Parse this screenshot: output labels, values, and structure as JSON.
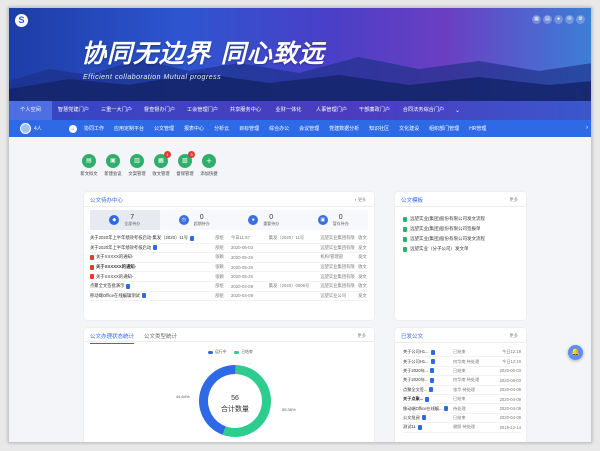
{
  "header": {
    "logo_glyph": "S",
    "slogan": "协同无边界 同心致远",
    "slogan_en": "Efficient collaboration Mutual progress",
    "top_icons": [
      "grid-icon",
      "apps-icon",
      "user-icon",
      "chat-icon",
      "settings-icon"
    ]
  },
  "nav_main": {
    "items": [
      "个人空间",
      "智慧党建门户",
      "三重一大门户",
      "督查督办门户",
      "工会管理门户",
      "共享服务中心",
      "业财一体化",
      "人事管理门户",
      "干部廉政门户",
      "合同法务综合门户"
    ],
    "more": "⌄"
  },
  "nav_sub": {
    "user_count": "4人",
    "items": [
      "协同工作",
      "应用定制平台",
      "公文管理",
      "报表中心",
      "分析云",
      "目标管理",
      "综合办公",
      "会议管理",
      "党建数据分析",
      "知识社区",
      "文化建设",
      "组织部门管理",
      "HR管理"
    ]
  },
  "quick_actions": [
    {
      "label": "新文拟文",
      "color": "#2eaf6a",
      "badge": ""
    },
    {
      "label": "新建会议",
      "color": "#2eaf6a",
      "badge": ""
    },
    {
      "label": "文案管理",
      "color": "#2eaf6a",
      "badge": ""
    },
    {
      "label": "收文管理",
      "color": "#2eaf6a",
      "badge": "1"
    },
    {
      "label": "督保管理",
      "color": "#2eaf6a",
      "badge": "3"
    },
    {
      "label": "添加快捷",
      "color": "#2eaf6a",
      "badge": ""
    }
  ],
  "pending": {
    "title": "公文待办中心",
    "toggle": "更多",
    "stats": [
      {
        "num": "7",
        "label": "全部待办",
        "color": "#2f6ae6"
      },
      {
        "num": "0",
        "label": "超期待办",
        "color": "#3b6fe0"
      },
      {
        "num": "0",
        "label": "重要待办",
        "color": "#3b6fe0"
      },
      {
        "num": "0",
        "label": "暂存待办",
        "color": "#3b6fe0"
      }
    ],
    "rows": [
      {
        "title": "关于2020年上半年绩效考核启动-集发〔2020〕11号",
        "icon": "blue",
        "type": "部组",
        "date": "今日11:57",
        "doc": "集发〔2020〕11号",
        "org": "远望实业集团有限",
        "kind": "收文",
        "bold": false
      },
      {
        "title": "关于2020年上半年绩效考核启动",
        "icon": "blue",
        "type": "部组",
        "date": "2020-06-03",
        "doc": "",
        "org": "远望实业集团有限",
        "kind": "发文",
        "bold": false
      },
      {
        "title": "关于XXXXX的通知-",
        "icon": "red",
        "type": "张颖",
        "date": "2020-05-26",
        "doc": "",
        "org": "机构/管理部",
        "kind": "发文",
        "bold": false
      },
      {
        "title": "关于XXXXXX的通知-",
        "icon": "red",
        "type": "张颖",
        "date": "2020-05-26",
        "doc": "",
        "org": "远望实业集团有限",
        "kind": "收文",
        "bold": true
      },
      {
        "title": "关于XXXXX的通知-",
        "icon": "red",
        "type": "张颖",
        "date": "2020-05-26",
        "doc": "",
        "org": "远望实业集团有限",
        "kind": "发文",
        "bold": false
      },
      {
        "title": "点聚全文签批演示",
        "icon": "blue",
        "type": "部组",
        "date": "2020-04-09",
        "doc": "集发〔2020〕0006号",
        "org": "远望实业集团有限",
        "kind": "收文",
        "bold": false
      },
      {
        "title": "移动端Office在线编辑测试",
        "icon": "blue",
        "type": "部组",
        "date": "2020-04-09",
        "doc": "",
        "org": "远望实业公司",
        "kind": "发文",
        "bold": false
      }
    ]
  },
  "templates": {
    "title": "公文模板",
    "more": "更多",
    "items": [
      "远望实业(集团)股份有限公司发文流程",
      "远望实业(集团)股份有限公司签报单",
      "远望实业(集团)股份有限公司发文流程",
      "远望实业（分子公司）发文单"
    ]
  },
  "stats_panel": {
    "tabs": [
      "公文办理状态统计",
      "公文类型统计"
    ],
    "more": "更多",
    "chart_data": {
      "type": "pie",
      "labels": [
        "运行中",
        "已结束"
      ],
      "values": [
        44.64,
        55.36
      ],
      "value_labels": [
        "44.64%",
        "55.36%"
      ],
      "colors": [
        "#2f6ae6",
        "#2ecc8f"
      ],
      "center_value": "56",
      "center_label": "合计数量"
    }
  },
  "done": {
    "title": "已发公文",
    "more": "更多",
    "rows": [
      {
        "title": "关于公司H1...",
        "who": "已结束",
        "date": "今日12:19",
        "bold": false
      },
      {
        "title": "关于公司H1...",
        "who": "何华南 待处理",
        "date": "今日12:19",
        "bold": false
      },
      {
        "title": "关于2020年...",
        "who": "已结束",
        "date": "2020-06-03",
        "bold": false
      },
      {
        "title": "关于2020年...",
        "who": "何华南 待处理",
        "date": "2020-06-03",
        "bold": false
      },
      {
        "title": "点聚全文签...",
        "who": "张华 待处理",
        "date": "2020-04-09",
        "bold": false
      },
      {
        "title": "关于点聚...",
        "who": "已结束",
        "date": "2020-04-09",
        "bold": true
      },
      {
        "title": "移动端Office在线编...",
        "who": "待处理",
        "date": "2020-04-09",
        "bold": false
      },
      {
        "title": "公文批阅",
        "who": "已结束",
        "date": "2020-04-09",
        "bold": false
      },
      {
        "title": "测试11",
        "who": "谢照 待处理",
        "date": "2019-12-14",
        "bold": false
      }
    ]
  }
}
